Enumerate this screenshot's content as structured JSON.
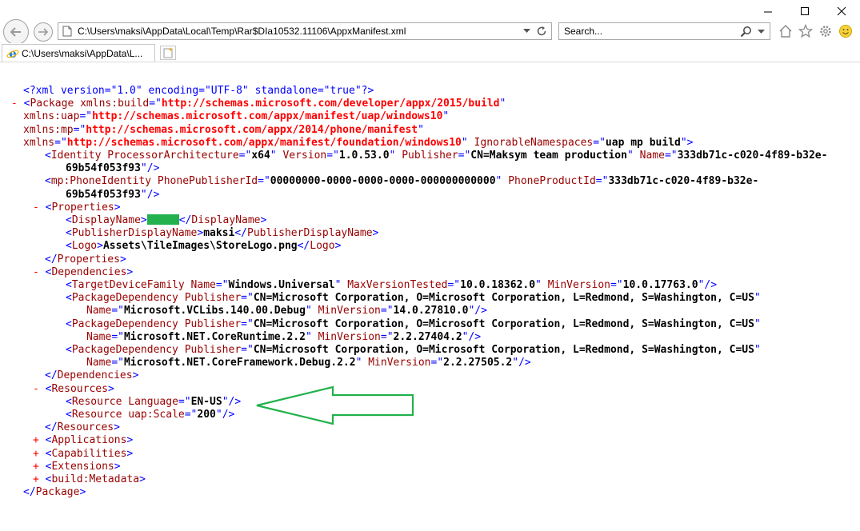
{
  "address": {
    "url": "C:\\Users\\maksi\\AppData\\Local\\Temp\\Rar$DIa10532.11106\\AppxManifest.xml"
  },
  "search": {
    "placeholder": "Search..."
  },
  "tab": {
    "title": "C:\\Users\\maksi\\AppData\\L..."
  },
  "xml": {
    "decl": "<?xml version=\"1.0\" encoding=\"UTF-8\" standalone=\"true\"?>",
    "package": {
      "ns_build_attr": "xmlns:build",
      "ns_build_val": "http://schemas.microsoft.com/developer/appx/2015/build",
      "ns_uap_attr": "xmlns:uap",
      "ns_uap_val": "http://schemas.microsoft.com/appx/manifest/uap/windows10",
      "ns_mp_attr": "xmlns:mp",
      "ns_mp_val": "http://schemas.microsoft.com/appx/2014/phone/manifest",
      "ns_attr": "xmlns",
      "ns_val": "http://schemas.microsoft.com/appx/manifest/foundation/windows10",
      "ign_attr": "IgnorableNamespaces",
      "ign_val": "uap mp build"
    },
    "identity": {
      "arch": "x64",
      "version": "1.0.53.0",
      "publisher": "CN=Maksym team production",
      "name1": "333db71c-c020-4f89-b32e-",
      "name2": "69b54f053f93"
    },
    "phone": {
      "pub_id": "00000000-0000-0000-0000-000000000000",
      "prod1": "333db71c-c020-4f89-b32e-",
      "prod2": "69b54f053f93"
    },
    "properties": {
      "publisher_display_name": "maksi",
      "logo": "Assets\\TileImages\\StoreLogo.png"
    },
    "dependencies": {
      "target_name": "Windows.Universal",
      "max_tested": "10.0.18362.0",
      "min_version": "10.0.17763.0",
      "publisher": "CN=Microsoft Corporation, O=Microsoft Corporation, L=Redmond, S=Washington, C=US",
      "packages": [
        {
          "name": "Microsoft.VCLibs.140.00.Debug",
          "min": "14.0.27810.0"
        },
        {
          "name": "Microsoft.NET.CoreRuntime.2.2",
          "min": "2.2.27404.2"
        },
        {
          "name": "Microsoft.NET.CoreFramework.Debug.2.2",
          "min": "2.2.27505.2"
        }
      ]
    },
    "resources": {
      "language": "EN-US",
      "scale": "200"
    },
    "collapsed": [
      "Applications",
      "Capabilities",
      "Extensions",
      "build:Metadata"
    ]
  }
}
